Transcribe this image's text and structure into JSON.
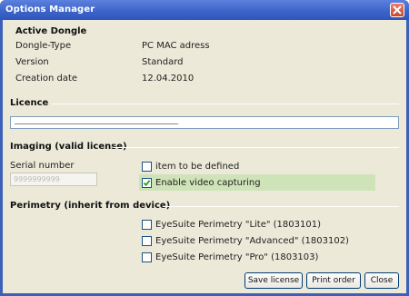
{
  "window": {
    "title": "Options Manager"
  },
  "dongle": {
    "heading": "Active Dongle",
    "rows": [
      {
        "label": "Dongle-Type",
        "value": "PC MAC adress"
      },
      {
        "label": "Version",
        "value": "Standard"
      },
      {
        "label": "Creation date",
        "value": "12.04.2010"
      }
    ]
  },
  "licence": {
    "heading": "Licence"
  },
  "imaging": {
    "heading": "Imaging   (valid license)",
    "serial_label": "Serial number",
    "serial_placeholder": "9999999999",
    "options": [
      {
        "label": "item to be defined",
        "checked": false
      },
      {
        "label": "Enable video capturing",
        "checked": true
      }
    ],
    "highlight_color": "#cfe3b8"
  },
  "perimetry": {
    "heading": "Perimetry   (inherit from device)",
    "options": [
      {
        "label": "EyeSuite Perimetry \"Lite\" (1803101)",
        "checked": false
      },
      {
        "label": "EyeSuite Perimetry \"Advanced\" (1803102)",
        "checked": false
      },
      {
        "label": "EyeSuite Perimetry \"Pro\" (1803103)",
        "checked": false
      }
    ]
  },
  "buttons": {
    "save": "Save license",
    "print": "Print order",
    "close": "Close"
  },
  "colors": {
    "titlebar": "#3a63c9",
    "dialog_bg": "#ece9d8",
    "close_button": "#c9452b"
  },
  "icons": {
    "close": "close-x-icon",
    "check": "check-icon"
  }
}
